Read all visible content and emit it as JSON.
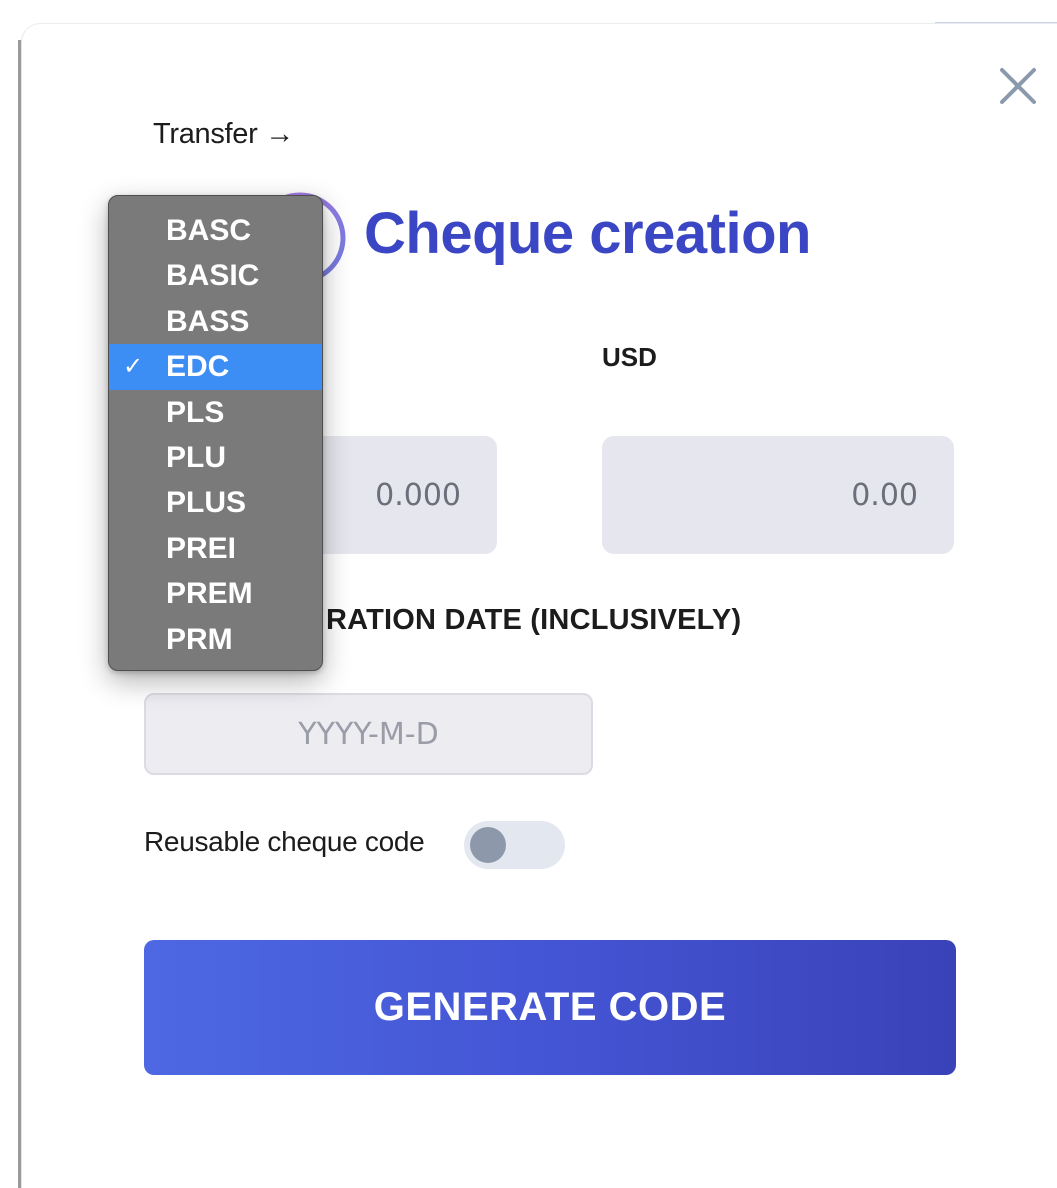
{
  "modal": {
    "transfer_link": "Transfer →",
    "title": "Cheque creation",
    "currency_label": "USD",
    "amount_token_value": "0.000",
    "amount_usd_value": "0.00",
    "expiry_label_visible": "RATION DATE (INCLUSIVELY)",
    "date_placeholder": "YYYY-M-D",
    "reusable_label": "Reusable cheque code",
    "reusable_enabled": false,
    "generate_button": "GENERATE CODE"
  },
  "token_dropdown": {
    "options": [
      "BASC",
      "BASIC",
      "BASS",
      "EDC",
      "PLS",
      "PLU",
      "PLUS",
      "PREI",
      "PREM",
      "PRM"
    ],
    "selected": "EDC",
    "check_glyph": "✓"
  },
  "icons": {
    "close": "close-icon",
    "heading": "cheque-icon"
  },
  "colors": {
    "title": "#3b46c4",
    "button_start": "#4d68e2",
    "button_end": "#3a42b8",
    "selected_option": "#3c8ef5",
    "input_bg": "#e6e7ee"
  }
}
